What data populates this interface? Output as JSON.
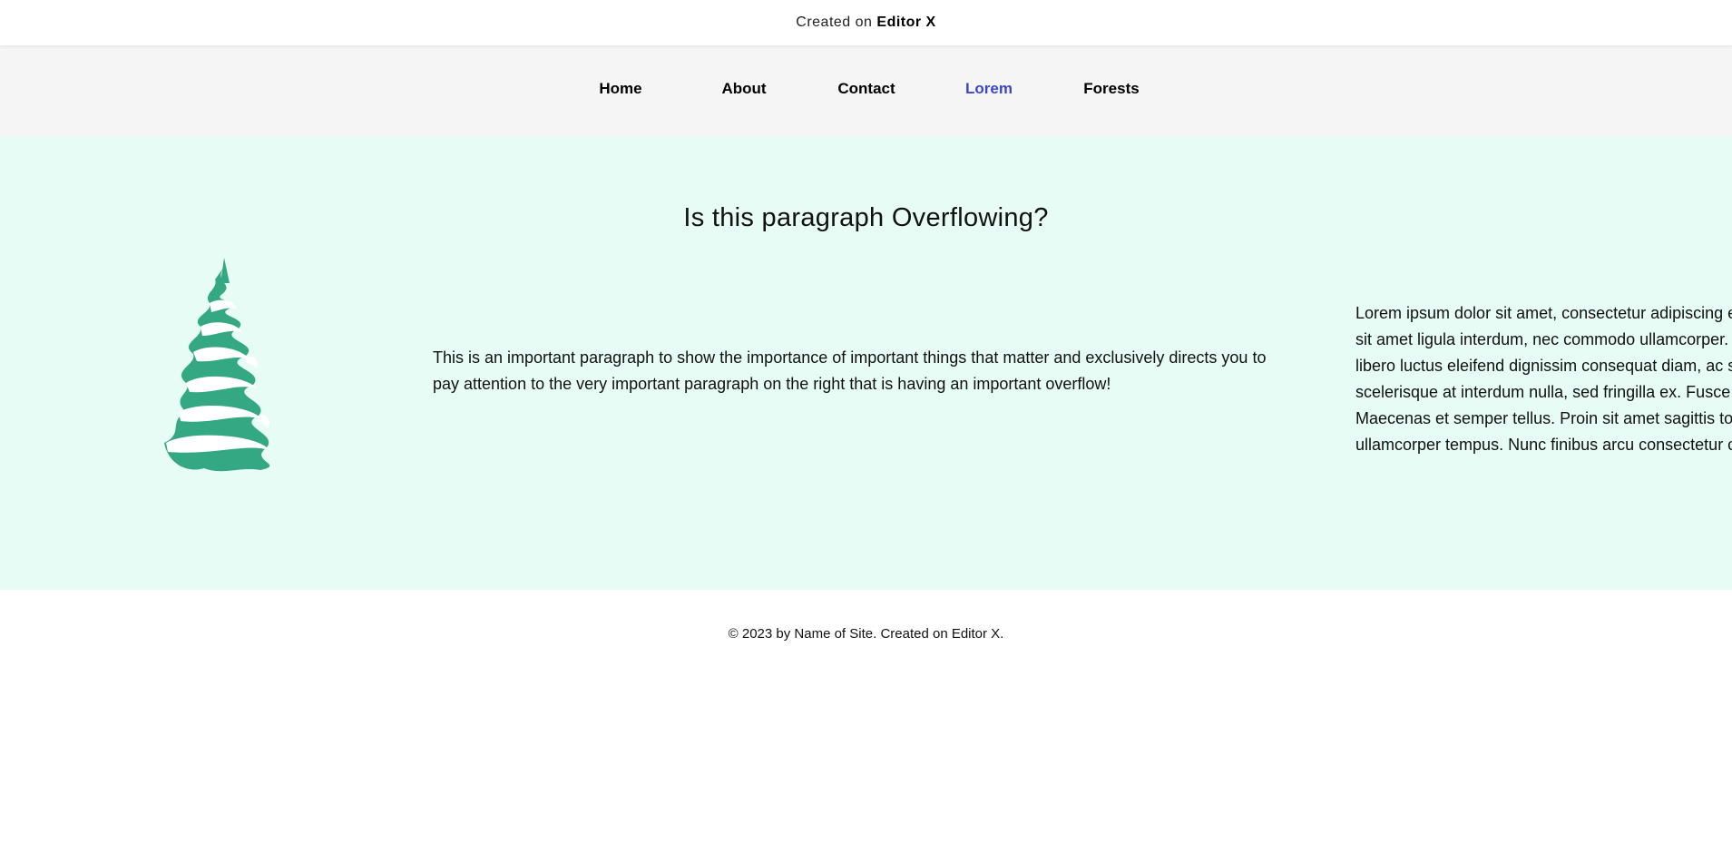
{
  "topbar": {
    "prefix": "Created on",
    "brand": "Editor X"
  },
  "nav": {
    "items": [
      {
        "label": "Home"
      },
      {
        "label": "About"
      },
      {
        "label": "Contact"
      },
      {
        "label": "Lorem",
        "active": true
      },
      {
        "label": "Forests"
      }
    ],
    "active_color": "#3b48c6"
  },
  "main": {
    "heading": "Is this paragraph Overflowing?",
    "paragraph_left": "This is an important paragraph to show the importance of important things that matter and exclusively directs you to pay attention to the very important paragraph on the right that is having an important overflow!",
    "paragraph_right": "Lorem ipsum dolor sit amet, consectetur adipiscing elit. Nulla vulputate erat sit amet ligula interdum, nec commodo ullamcorper. Nulla feugiat libero et libero luctus eleifend dignissim consequat diam, ac suscipit ipsum scelerisque at interdum nulla, sed fringilla ex. Fusce viverra lacinia Maecenas et semper tellus. Proin sit amet sagittis tortor odio ut enim ullamcorper tempus. Nunc finibus arcu consectetur commodo.",
    "image": "snowy-pine-tree-illustration",
    "background_color": "#e8fcf6",
    "tree_color": "#34a882"
  },
  "footer": {
    "text": "© 2023 by Name of Site. Created on Editor X."
  }
}
